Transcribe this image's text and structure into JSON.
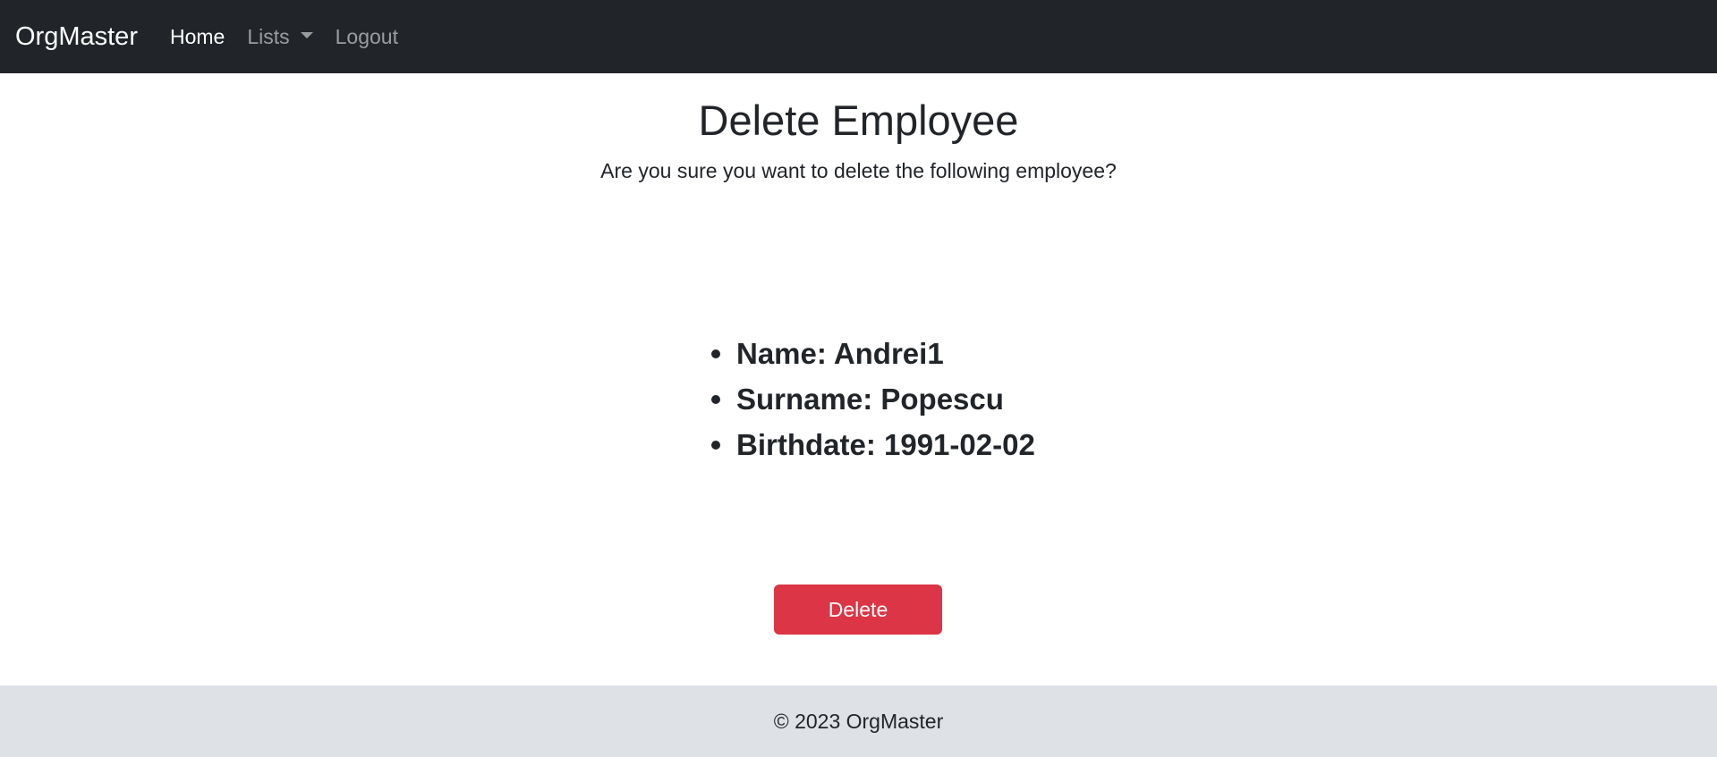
{
  "navbar": {
    "brand": "OrgMaster",
    "links": [
      {
        "label": "Home"
      },
      {
        "label": "Lists"
      },
      {
        "label": "Logout"
      }
    ]
  },
  "page": {
    "title": "Delete Employee",
    "subtitle": "Are you sure you want to delete the following employee?"
  },
  "employee": {
    "details": [
      {
        "text": "Name: Andrei1"
      },
      {
        "text": "Surname: Popescu"
      },
      {
        "text": "Birthdate: 1991-02-02"
      }
    ]
  },
  "actions": {
    "delete_label": "Delete"
  },
  "footer": {
    "text": "© 2023 OrgMaster"
  },
  "colors": {
    "navbar_bg": "#212529",
    "danger": "#dc3545",
    "footer_bg": "#dee2e6"
  }
}
